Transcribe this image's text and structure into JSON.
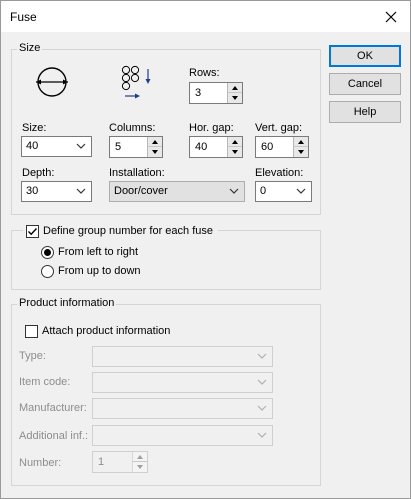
{
  "window": {
    "title": "Fuse"
  },
  "buttons": {
    "ok": "OK",
    "cancel": "Cancel",
    "help": "Help"
  },
  "size_group": {
    "legend": "Size",
    "rows": {
      "label": "Rows:",
      "value": "3"
    },
    "size": {
      "label": "Size:",
      "value": "40"
    },
    "columns": {
      "label": "Columns:",
      "value": "5"
    },
    "hor_gap": {
      "label": "Hor. gap:",
      "value": "40"
    },
    "vert_gap": {
      "label": "Vert. gap:",
      "value": "60"
    },
    "depth": {
      "label": "Depth:",
      "value": "30"
    },
    "installation": {
      "label": "Installation:",
      "value": "Door/cover"
    },
    "elevation": {
      "label": "Elevation:",
      "value": "0"
    }
  },
  "group_number": {
    "checkbox_label": "Define group number for each fuse",
    "checked": true,
    "options": [
      "From left to right",
      "From up to down"
    ],
    "selected": "From left to right"
  },
  "product_info": {
    "legend": "Product information",
    "attach_label": "Attach product information",
    "attach_checked": false,
    "fields": {
      "type": "Type:",
      "item_code": "Item code:",
      "manufacturer": "Manufacturer:",
      "additional_inf": "Additional inf.:",
      "number": "Number:"
    },
    "number_value": "1"
  },
  "icons": {
    "close": "close-icon",
    "fuse_symbol": "fuse-symbol-icon",
    "grid_order": "grid-order-icon",
    "dropdown": "chevron-down-icon",
    "check": "check-icon"
  },
  "colors": {
    "accent": "#0078d7",
    "dialog_bg": "#f0f0f0",
    "arrow_blue": "#1f3b8f"
  }
}
